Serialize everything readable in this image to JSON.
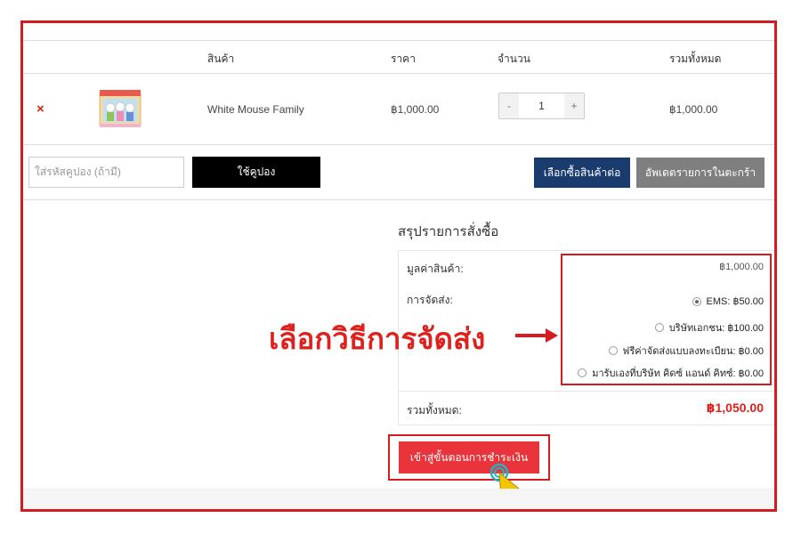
{
  "table": {
    "headers": {
      "product": "สินค้า",
      "price": "ราคา",
      "quantity": "จำนวน",
      "total": "รวมทั้งหมด"
    },
    "item": {
      "remove_symbol": "×",
      "name": "White Mouse Family",
      "price": "฿1,000.00",
      "quantity": "1",
      "minus": "-",
      "plus": "+",
      "line_total": "฿1,000.00"
    }
  },
  "coupon": {
    "placeholder": "ใส่รหัสคูปอง (ถ้ามี)",
    "apply_label": "ใช้คูปอง"
  },
  "actions": {
    "continue_label": "เลือกซื้อสินค้าต่อ",
    "update_label": "อัพเดตรายการในตะกร้า"
  },
  "summary": {
    "title": "สรุปรายการสั่งซื้อ",
    "subtotal_label": "มูลค่าสินค้า:",
    "subtotal_value": "฿1,000.00",
    "shipping_label": "การจัดส่ง:",
    "shipping_options": [
      {
        "label": "EMS: ฿50.00",
        "selected": true
      },
      {
        "label": "บริษัทเอกชน: ฿100.00",
        "selected": false
      },
      {
        "label": "ฟรีค่าจัดส่งแบบลงทะเบียน: ฿0.00",
        "selected": false
      },
      {
        "label": "มารับเองที่บริษัท คิดซ์ แอนด์ คิทซ์: ฿0.00",
        "selected": false
      }
    ],
    "total_label": "รวมทั้งหมด:",
    "total_value": "฿1,050.00"
  },
  "annotation": {
    "text": "เลือกวิธีการจัดส่ง"
  },
  "checkout": {
    "label": "เข้าสู่ขั้นตอนการชำระเงิน"
  },
  "colors": {
    "highlight_red": "#d71920",
    "checkout_red": "#e8343a",
    "navy": "#1a3b6e",
    "gray_button": "#7f7f7f",
    "cursor_yellow": "#f7c600"
  }
}
